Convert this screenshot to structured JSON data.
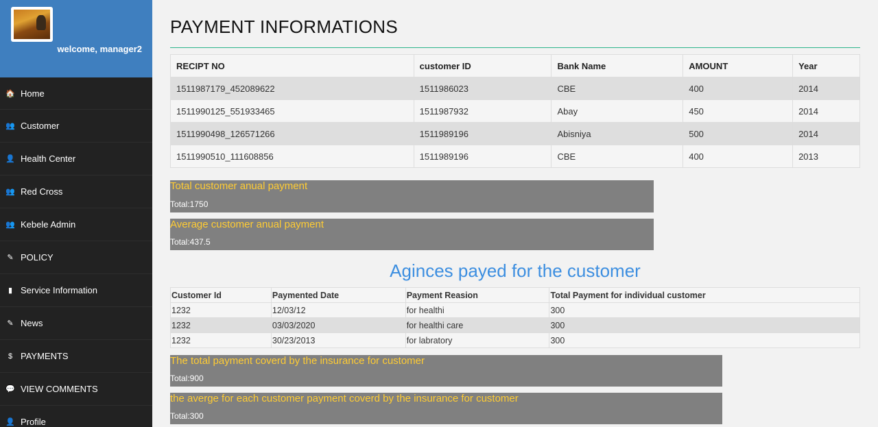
{
  "sidebar": {
    "welcome": "welcome, manager2",
    "items": [
      {
        "label": "Home",
        "icon": "home-icon",
        "glyph": "🏠"
      },
      {
        "label": "Customer",
        "icon": "users-icon",
        "glyph": "👥"
      },
      {
        "label": "Health Center",
        "icon": "user-icon",
        "glyph": "👤"
      },
      {
        "label": "Red Cross",
        "icon": "users-icon",
        "glyph": "👥"
      },
      {
        "label": "Kebele Admin",
        "icon": "users-icon",
        "glyph": "👥"
      },
      {
        "label": "POLICY",
        "icon": "edit-icon",
        "glyph": "✎"
      },
      {
        "label": "Service Information",
        "icon": "book-icon",
        "glyph": "▮"
      },
      {
        "label": "News",
        "icon": "edit-icon",
        "glyph": "✎"
      },
      {
        "label": "PAYMENTS",
        "icon": "dollar-icon",
        "glyph": "$"
      },
      {
        "label": "VIEW COMMENTS",
        "icon": "comment-icon",
        "glyph": "💬"
      },
      {
        "label": "Profile",
        "icon": "user-icon",
        "glyph": "👤"
      }
    ]
  },
  "main": {
    "title": "PAYMENT INFORMATIONS",
    "payments_table": {
      "headers": [
        "RECIPT NO",
        "customer ID",
        "Bank Name",
        "AMOUNT",
        "Year"
      ],
      "rows": [
        [
          "1511987179_452089622",
          "1511986023",
          "CBE",
          "400",
          "2014"
        ],
        [
          "1511990125_551933465",
          "1511987932",
          "Abay",
          "450",
          "2014"
        ],
        [
          "1511990498_126571266",
          "1511989196",
          "Abisniya",
          "500",
          "2014"
        ],
        [
          "1511990510_111608856",
          "1511989196",
          "CBE",
          "400",
          "2013"
        ]
      ]
    },
    "total_box": {
      "heading": "Total customer anual payment",
      "total": "Total:1750"
    },
    "average_box": {
      "heading": "Average customer anual payment",
      "total": "Total:437.5"
    },
    "agencies_heading": "Aginces payed for the customer",
    "agency_table": {
      "headers": [
        "Customer Id",
        "Paymented Date",
        "Payment Reasion",
        "Total Payment for individual customer"
      ],
      "rows": [
        [
          "1232",
          "12/03/12",
          "for healthi",
          "300"
        ],
        [
          "1232",
          "03/03/2020",
          "for healthi care",
          "300"
        ],
        [
          "1232",
          "30/23/2013",
          "for labratory",
          "300"
        ]
      ]
    },
    "insurance_total_box": {
      "heading": "The total payment coverd by the insurance for customer",
      "total": "Total:900"
    },
    "insurance_avg_box": {
      "heading": "the averge for each customer payment coverd by the insurance for customer",
      "total": "Total:300"
    }
  },
  "colors": {
    "sidebar_bg": "#222222",
    "profile_bg": "#3f7fbf",
    "accent_rule": "#2bb48b",
    "box_bg": "#808080",
    "box_heading": "#ffcc33",
    "section_heading": "#3c8ee0"
  }
}
